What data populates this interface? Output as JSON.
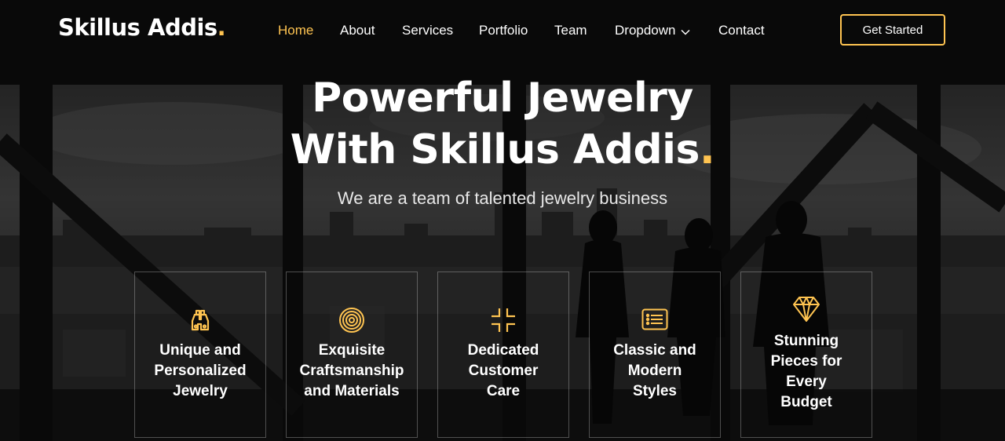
{
  "brand": {
    "name": "Skillus Addis",
    "dot": ".",
    "accent": "#ffc451"
  },
  "nav": {
    "items": [
      {
        "label": "Home",
        "active": true
      },
      {
        "label": "About"
      },
      {
        "label": "Services"
      },
      {
        "label": "Portfolio"
      },
      {
        "label": "Team"
      },
      {
        "label": "Dropdown",
        "icon": "chevron-down-icon"
      },
      {
        "label": "Contact"
      }
    ],
    "cta_label": "Get Started"
  },
  "hero": {
    "title_line1": "Powerful Jewelry",
    "title_line2": "With Skillus Addis",
    "title_dot": ".",
    "subtitle": "We are a team of talented jewelry business"
  },
  "features": [
    {
      "icon": "binoculars-icon",
      "lines": [
        "Unique and",
        "Personalized",
        "Jewelry"
      ]
    },
    {
      "icon": "target-icon",
      "lines": [
        "Exquisite",
        "Craftsmanship",
        "and Materials"
      ]
    },
    {
      "icon": "fullscreen-exit-icon",
      "lines": [
        "Dedicated",
        "Customer",
        "Care"
      ]
    },
    {
      "icon": "card-list-icon",
      "lines": [
        "Classic and",
        "Modern",
        "Styles"
      ]
    },
    {
      "icon": "gem-icon",
      "lines": [
        "Stunning",
        "Pieces for",
        "Every",
        "Budget"
      ]
    }
  ]
}
